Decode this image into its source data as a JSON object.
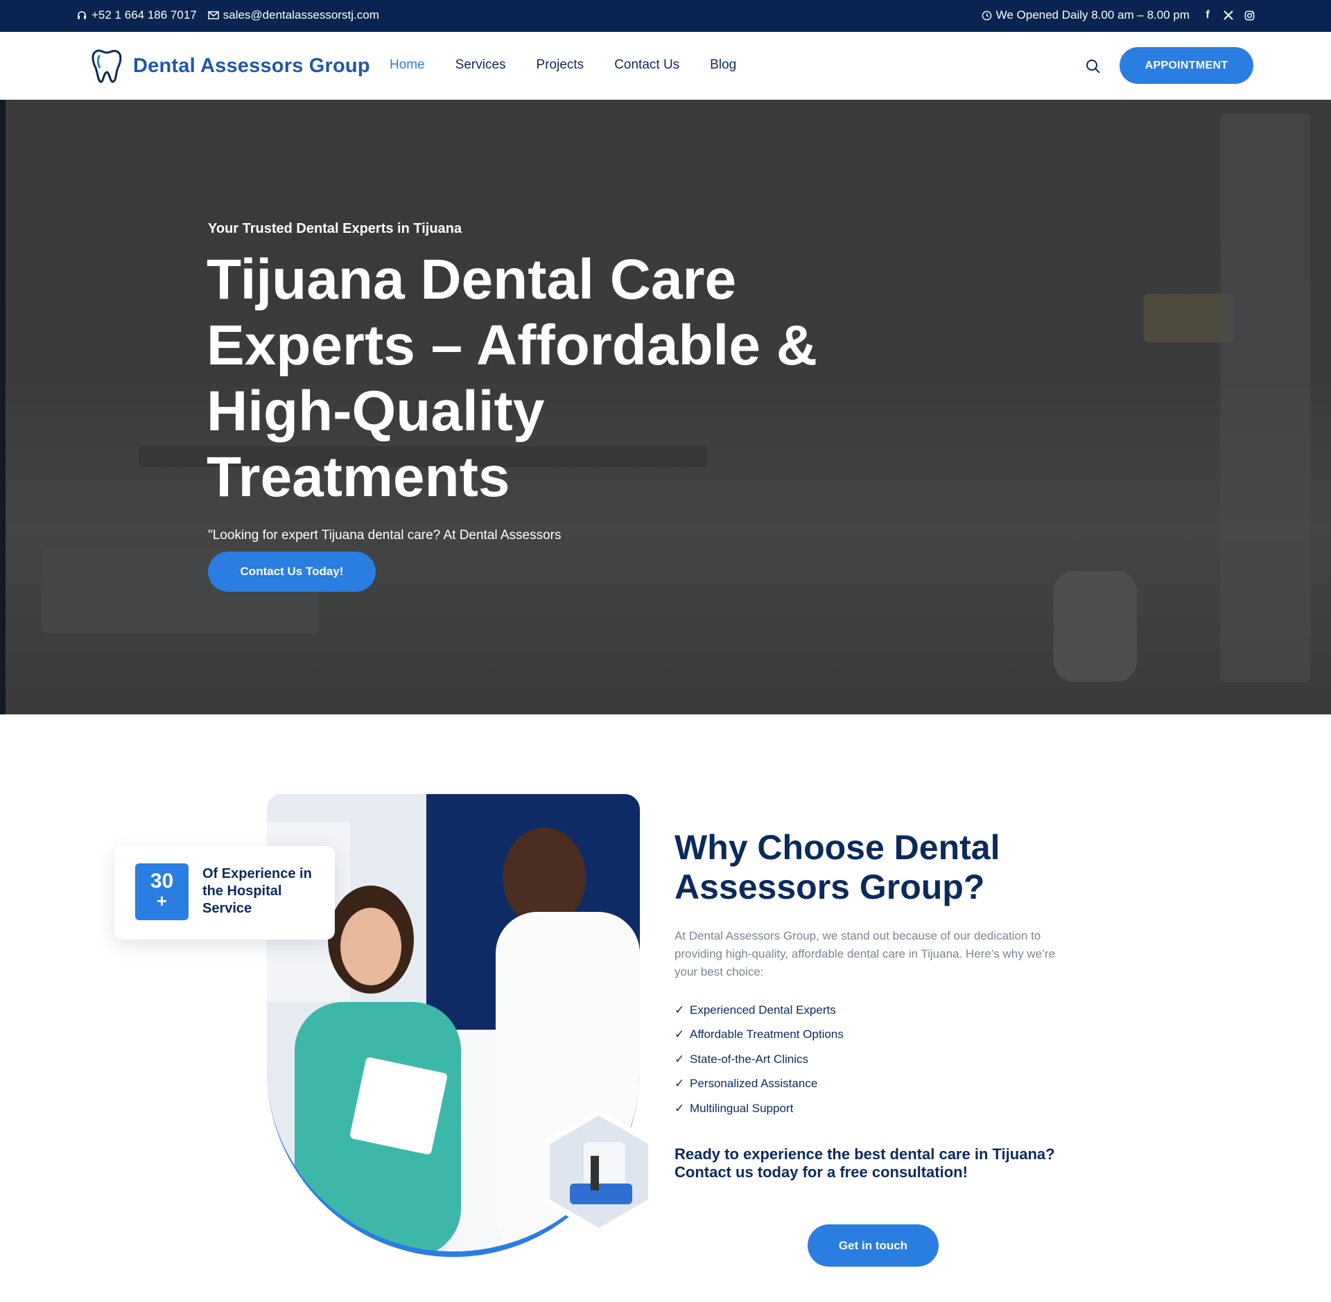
{
  "topbar": {
    "phone": "+52 1 664 186 7017",
    "email": "sales@dentalassessorstj.com",
    "hours": "We Opened Daily 8.00 am – 8.00 pm",
    "social_icons": [
      "facebook-icon",
      "x-icon",
      "instagram-icon"
    ]
  },
  "header": {
    "logo_text": "Dental Assessors Group",
    "nav": [
      {
        "label": "Home",
        "active": true
      },
      {
        "label": "Services"
      },
      {
        "label": "Projects"
      },
      {
        "label": "Contact Us"
      },
      {
        "label": "Blog"
      }
    ],
    "appointment_label": "APPOINTMENT"
  },
  "hero": {
    "eyebrow": "Your Trusted Dental Experts in Tijuana",
    "title": "Tijuana Dental Care Experts – Affordable & High-Quality Treatments",
    "lead": "\"Looking for expert Tijuana dental care? At Dental Assessors",
    "cta_label": "Contact Us Today!"
  },
  "why": {
    "experience_number": "30",
    "experience_plus": "+",
    "experience_text": "Of Experience in the Hospital Service",
    "title": "Why Choose Dental Assessors Group?",
    "body": "At Dental Assessors Group, we stand out because of our dedication to providing high-quality, affordable dental care in Tijuana. Here’s why we’re your best choice:",
    "checks": [
      "Experienced Dental Experts",
      "Affordable Treatment Options",
      "State-of-the-Art Clinics",
      "Personalized Assistance",
      "Multilingual Support"
    ],
    "ready": "Ready to experience the best dental care in Tijuana? Contact us today for a free consultation!",
    "cta_label": "Get in touch"
  },
  "colors": {
    "navy": "#0a2350",
    "accent": "#2a7de1",
    "heading": "#0b2a5c",
    "muted": "#7a8492"
  }
}
